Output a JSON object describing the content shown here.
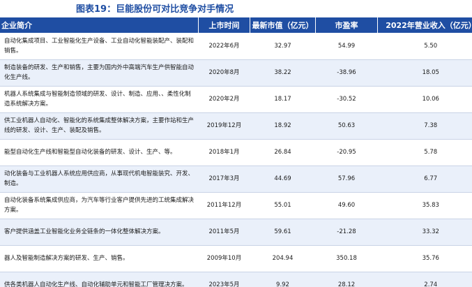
{
  "title": "图表19：巨能股份可对比竞争对手情况",
  "columns": {
    "desc": "企业简介",
    "date": "上市时间",
    "mv": "最新市值（亿元）",
    "pe": "市盈率",
    "rev": "2022年营业收入（亿元）"
  },
  "rows": [
    {
      "desc": "自动化集成项目、工业智能化生产设备、工业自动化智能装配产、装配和销售。",
      "date": "2022年6月",
      "mv": "32.97",
      "pe": "54.99",
      "rev": "5.50"
    },
    {
      "desc": "制造装备的研发、生产和销售，主要为国内外中高端汽车生产供智能自动化生产线。",
      "date": "2020年8月",
      "mv": "38.22",
      "pe": "-38.96",
      "rev": "18.05"
    },
    {
      "desc": "机器人系统集成与智能制造领域的研发、设计、制造、应用、、柔性化制造系统解决方案。",
      "date": "2020年2月",
      "mv": "18.17",
      "pe": "-30.52",
      "rev": "10.06"
    },
    {
      "desc": "供工业机器人自动化、智能化的系统集成整体解决方案，主要作站和生产线的研发、设计、生产、装配及销售。",
      "date": "2019年12月",
      "mv": "18.92",
      "pe": "50.63",
      "rev": "7.38"
    },
    {
      "desc": "能型自动化生产线和智能型自动化装备的研发、设计、生产、等。",
      "date": "2018年1月",
      "mv": "26.84",
      "pe": "-20.95",
      "rev": "5.78"
    },
    {
      "desc": "动化装备与工业机器人系统应用供应商，从事现代机电智能装究、开发、制造。",
      "date": "2017年3月",
      "mv": "44.69",
      "pe": "57.96",
      "rev": "6.77"
    },
    {
      "desc": "自动化装备系统集成供应商，为汽车等行业客户提供先进的工统集成解决方案。",
      "date": "2011年12月",
      "mv": "55.01",
      "pe": "49.60",
      "rev": "35.83"
    },
    {
      "desc": "客户提供涵盖工业智能化业务全链条的一体化整体解决方案。",
      "date": "2011年5月",
      "mv": "59.61",
      "pe": "-21.28",
      "rev": "33.32"
    },
    {
      "desc": "器人及智能制造解决方案的研发、生产、销售。",
      "date": "2009年10月",
      "mv": "204.94",
      "pe": "350.18",
      "rev": "35.76"
    },
    {
      "desc": "供各类机器人自动化生产线、自动化辅助单元和智能工厂管理决方案。",
      "date": "2023年5月",
      "mv": "9.92",
      "pe": "28.12",
      "rev": "2.74"
    }
  ]
}
